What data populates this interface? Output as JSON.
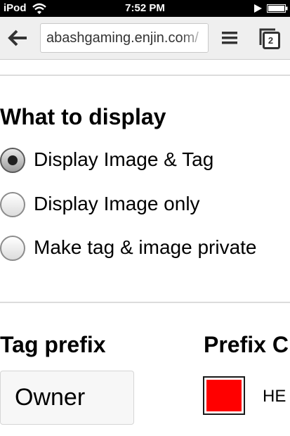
{
  "status_bar": {
    "carrier": "iPod",
    "time": "7:52 PM"
  },
  "browser": {
    "url": "abashgaming.enjin.com/",
    "tab_count": "2"
  },
  "display_section": {
    "title": "What to display",
    "options": [
      {
        "label": "Display Image & Tag",
        "selected": true
      },
      {
        "label": "Display Image only",
        "selected": false
      },
      {
        "label": "Make tag & image private",
        "selected": false
      }
    ]
  },
  "tag_prefix": {
    "label": "Tag prefix",
    "value": "Owner"
  },
  "prefix_color": {
    "label": "Prefix C",
    "hex_label": "HE",
    "color": "#ff0000"
  },
  "colors": {
    "status_bar_bg": "#000000",
    "toolbar_bg": "#efefef",
    "divider": "#dcdcdc"
  }
}
